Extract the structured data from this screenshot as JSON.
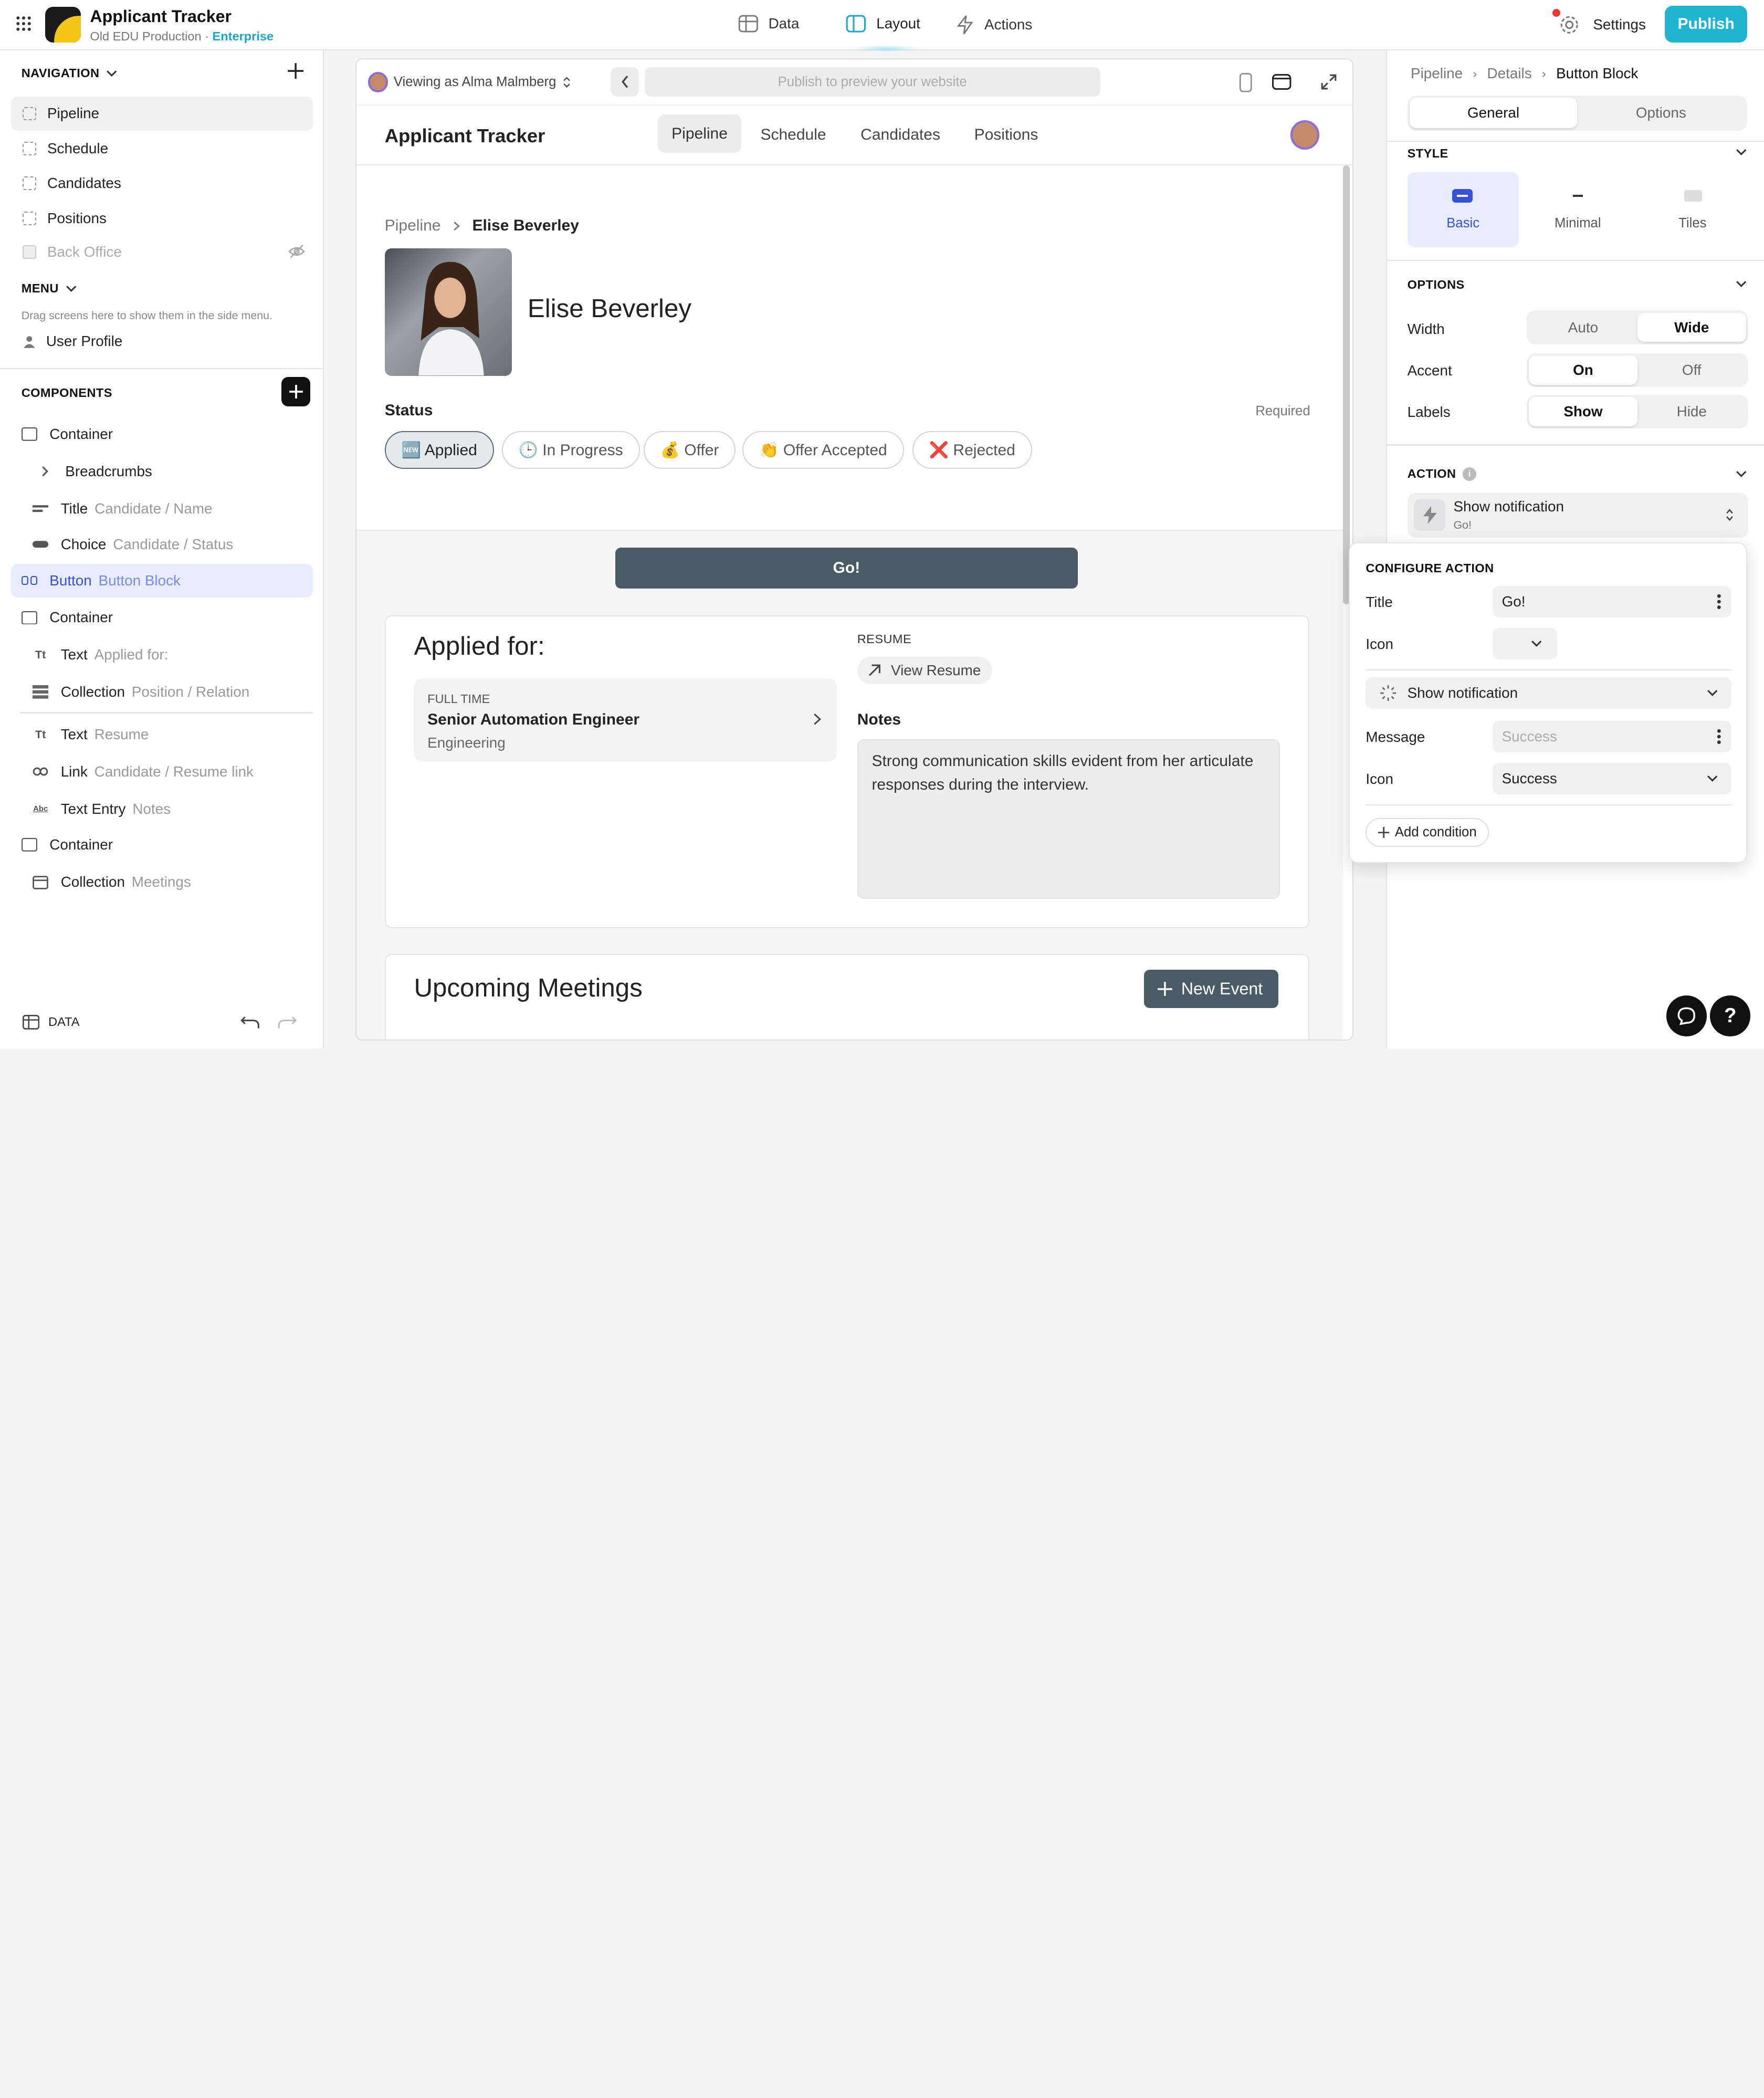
{
  "app": {
    "title": "Applicant Tracker",
    "env": "Old EDU Production",
    "plan": "Enterprise"
  },
  "topnav": {
    "data": "Data",
    "layout": "Layout",
    "actions": "Actions",
    "settings": "Settings",
    "publish": "Publish"
  },
  "sidebar": {
    "navigation_title": "NAVIGATION",
    "nav_items": [
      "Pipeline",
      "Schedule",
      "Candidates",
      "Positions",
      "Back Office"
    ],
    "menu_title": "MENU",
    "menu_hint": "Drag screens here to show them in the side menu.",
    "menu_item": "User Profile",
    "components_title": "COMPONENTS",
    "components": [
      {
        "label": "Container",
        "sub": ""
      },
      {
        "label": "Breadcrumbs",
        "sub": ""
      },
      {
        "label": "Title",
        "sub": "Candidate / Name"
      },
      {
        "label": "Choice",
        "sub": "Candidate / Status"
      },
      {
        "label": "Button",
        "sub": "Button Block"
      },
      {
        "label": "Container",
        "sub": ""
      },
      {
        "label": "Text",
        "sub": "Applied for:"
      },
      {
        "label": "Collection",
        "sub": "Position / Relation"
      },
      {
        "label": "Text",
        "sub": "Resume"
      },
      {
        "label": "Link",
        "sub": "Candidate / Resume link"
      },
      {
        "label": "Text Entry",
        "sub": "Notes"
      },
      {
        "label": "Container",
        "sub": ""
      },
      {
        "label": "Collection",
        "sub": "Meetings"
      }
    ],
    "data_label": "DATA"
  },
  "preview": {
    "viewing_as": "Viewing as Alma Malmberg",
    "url_placeholder": "Publish to preview your website",
    "app_title": "Applicant Tracker",
    "tabs": [
      "Pipeline",
      "Schedule",
      "Candidates",
      "Positions"
    ],
    "breadcrumb_root": "Pipeline",
    "breadcrumb_current": "Elise Beverley",
    "candidate_name": "Elise Beverley",
    "status_label": "Status",
    "required": "Required",
    "statuses": [
      "🆕 Applied",
      "🕒 In Progress",
      "💰 Offer",
      "👏 Offer Accepted",
      "❌ Rejected"
    ],
    "go_button": "Go!",
    "applied_for": "Applied for:",
    "position": {
      "type": "FULL TIME",
      "title": "Senior Automation Engineer",
      "dept": "Engineering"
    },
    "resume_label": "RESUME",
    "view_resume": "View Resume",
    "notes_label": "Notes",
    "notes_text": "Strong communication skills evident from her articulate responses during the interview.",
    "meetings_title": "Upcoming Meetings",
    "new_event": "New Event"
  },
  "inspector": {
    "breadcrumb": [
      "Pipeline",
      "Details",
      "Button Block"
    ],
    "tabs": [
      "General",
      "Options"
    ],
    "style_title": "STYLE",
    "styles": [
      "Basic",
      "Minimal",
      "Tiles"
    ],
    "options_title": "OPTIONS",
    "width": {
      "label": "Width",
      "opts": [
        "Auto",
        "Wide"
      ]
    },
    "accent": {
      "label": "Accent",
      "opts": [
        "On",
        "Off"
      ]
    },
    "labels": {
      "label": "Labels",
      "opts": [
        "Show",
        "Hide"
      ]
    },
    "action_title": "ACTION",
    "action_name": "Show notification",
    "action_sub": "Go!"
  },
  "configure": {
    "title": "CONFIGURE ACTION",
    "title_label": "Title",
    "title_value": "Go!",
    "icon_label": "Icon",
    "action": "Show notification",
    "message_label": "Message",
    "message_placeholder": "Success",
    "icon2_label": "Icon",
    "icon2_value": "Success",
    "add_condition": "Add condition"
  },
  "colors": {
    "accent": "#1fb5d1",
    "button_dark": "#4b5b66",
    "selected_bg": "#e8edfd",
    "basic_style": "#3a4fd8"
  }
}
